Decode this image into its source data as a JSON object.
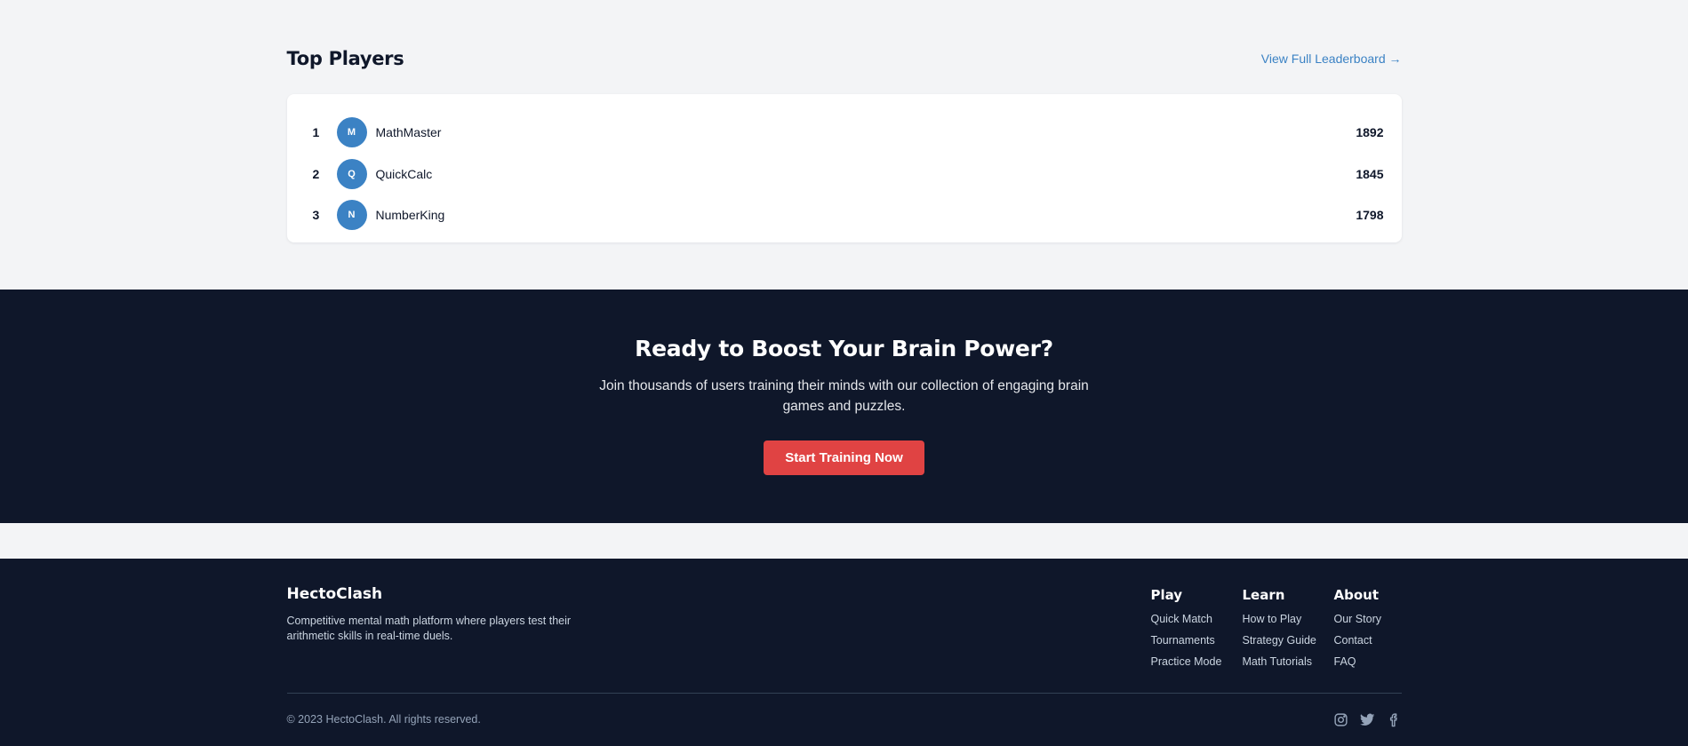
{
  "players": {
    "title": "Top Players",
    "leaderboard_link": "View Full Leaderboard →",
    "rows": [
      {
        "rank": "1",
        "initial": "M",
        "name": "MathMaster",
        "score": "1892"
      },
      {
        "rank": "2",
        "initial": "Q",
        "name": "QuickCalc",
        "score": "1845"
      },
      {
        "rank": "3",
        "initial": "N",
        "name": "NumberKing",
        "score": "1798"
      }
    ]
  },
  "cta": {
    "title": "Ready to Boost Your Brain Power?",
    "text": "Join thousands of users training their minds with our collection of engaging brain games and puzzles.",
    "button": "Start Training Now"
  },
  "footer": {
    "brand": "HectoClash",
    "description": "Competitive mental math platform where players test their arithmetic skills in real-time duels.",
    "columns": [
      {
        "title": "Play",
        "links": [
          "Quick Match",
          "Tournaments",
          "Practice Mode"
        ]
      },
      {
        "title": "Learn",
        "links": [
          "How to Play",
          "Strategy Guide",
          "Math Tutorials"
        ]
      },
      {
        "title": "About",
        "links": [
          "Our Story",
          "Contact",
          "FAQ"
        ]
      }
    ],
    "copyright": "© 2023 HectoClash. All rights reserved.",
    "socials": [
      "instagram-icon",
      "twitter-icon",
      "facebook-icon"
    ]
  },
  "colors": {
    "accent": "#3b82c4",
    "cta_button": "#e04343",
    "dark": "#0f172a",
    "light_bg": "#f3f4f6"
  }
}
